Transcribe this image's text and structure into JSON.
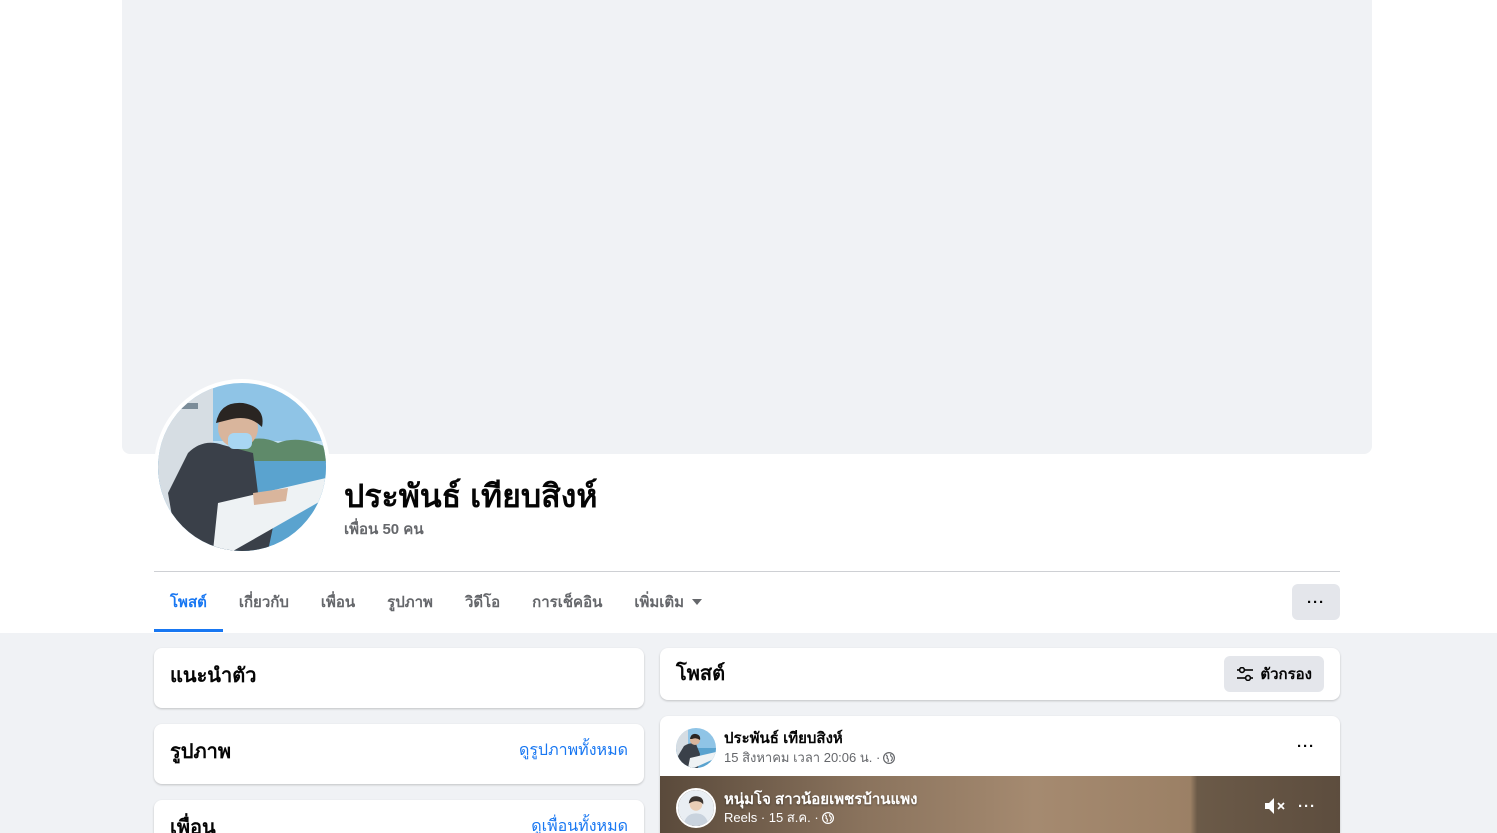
{
  "profile": {
    "name": "ประพันธ์ เทียบสิงห์",
    "friends": "เพื่อน 50 คน"
  },
  "tabs": [
    {
      "label": "โพสต์",
      "active": true
    },
    {
      "label": "เกี่ยวกับ"
    },
    {
      "label": "เพื่อน"
    },
    {
      "label": "รูปภาพ"
    },
    {
      "label": "วิดีโอ"
    },
    {
      "label": "การเช็คอิน"
    },
    {
      "label": "เพิ่มเติม"
    }
  ],
  "more_button": "···",
  "intro": {
    "title": "แนะนำตัว"
  },
  "photos": {
    "title": "รูปภาพ",
    "link": "ดูรูปภาพทั้งหมด"
  },
  "friends_section": {
    "title": "เพื่อน",
    "link": "ดูเพื่อนทั้งหมด"
  },
  "posts_header": {
    "title": "โพสต์",
    "filter_label": "ตัวกรอง"
  },
  "post": {
    "author": "ประพันธ์ เทียบสิงห์",
    "meta": "15 สิงหาคม เวลา 20:06 น. ·",
    "menu": "···",
    "reel": {
      "author": "หนุ่มโจ สาวน้อยเพชรบ้านแพง",
      "meta": "Reels · 15 ส.ค. ·",
      "menu": "···"
    }
  },
  "colors": {
    "accent": "#1877f2",
    "page_bg": "#f0f2f5",
    "secondary_text": "#65676b",
    "button_bg": "#e4e6eb"
  },
  "icons": [
    "caret-down-icon",
    "filter-icon",
    "globe-icon",
    "mute-icon",
    "more-dots-icon"
  ]
}
